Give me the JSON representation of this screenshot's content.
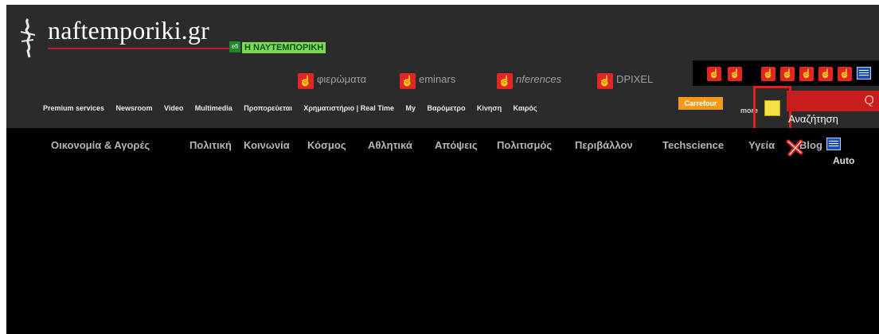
{
  "brand": {
    "logo_text": "naftemporiki.gr",
    "badge": "Η ΝΑΥΤΕΜΠΟΡΙΚΗ",
    "tiny_logo": "efi"
  },
  "sub_links": [
    {
      "label": "φιερώματα",
      "italic": false
    },
    {
      "label": "eminars",
      "italic": false
    },
    {
      "label": "nferences",
      "italic": true
    },
    {
      "label": "DPIXEL",
      "italic": false
    }
  ],
  "top_nav": [
    "Premium services",
    "Newsroom",
    "Video",
    "Multimedia",
    "Προπορεύεται",
    "Χρηματιστήριο | Real Time",
    "My",
    "Βαρόμετρο",
    "Κίνηση",
    "Καιρός"
  ],
  "carrefour_label": "Carrefour",
  "search": {
    "label": "Αναζήτηση",
    "more": "more"
  },
  "main_nav": [
    "Οικονομία & Αγορές",
    "Πολιτική",
    "Κοινωνία",
    "Κόσμος",
    "Αθλητικά",
    "Απόψεις",
    "Πολιτισμός",
    "Περιβάλλον",
    "Techscience",
    "Υγεία",
    "Blog"
  ],
  "auto_label": "Auto",
  "icons": {
    "pointer": "hand-pointer-icon",
    "list": "list-icon",
    "close": "close-x-icon",
    "search": "search-icon"
  },
  "colors": {
    "accent_red": "#e12626",
    "header_bg": "#2b2b2b",
    "badge_bg": "#7ed957",
    "carrefour_bg": "#f39a1c"
  }
}
